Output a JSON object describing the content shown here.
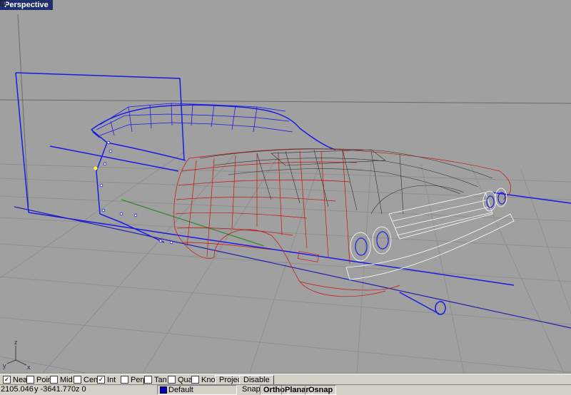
{
  "viewport": {
    "title": "Perspective",
    "axis": {
      "x": "x",
      "y": "y",
      "z": "z"
    }
  },
  "osnaps": [
    {
      "label": "Near",
      "checked": true
    },
    {
      "label": "Point",
      "checked": false
    },
    {
      "label": "Mid",
      "checked": false
    },
    {
      "label": "Cen",
      "checked": false
    },
    {
      "label": "Int",
      "checked": true
    },
    {
      "label": "Perp",
      "checked": false
    },
    {
      "label": "Tan",
      "checked": false
    },
    {
      "label": "Quad",
      "checked": false
    },
    {
      "label": "Knot",
      "checked": false
    }
  ],
  "osnap_buttons": {
    "project": "Project",
    "disable": "Disable"
  },
  "status": {
    "x": "2105.046",
    "y": "y -3641.770",
    "z": "z 0",
    "layer": "Default",
    "layer_color": "#0000c8",
    "snap": "Snap",
    "ortho": "Ortho",
    "planar": "Planar",
    "osnap": "Osnap"
  }
}
